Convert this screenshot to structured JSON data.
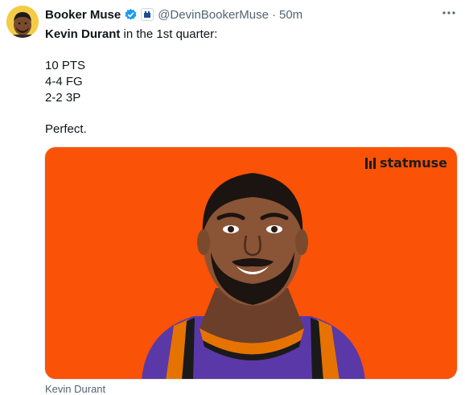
{
  "author": {
    "display_name": "Booker Muse",
    "handle": "@DevinBookerMuse",
    "separator": "·",
    "time": "50m"
  },
  "tweet": {
    "mention": "Kevin Durant",
    "intro_rest": " in the 1st quarter:",
    "stats": [
      "10 PTS",
      "4-4 FG",
      "2-2 3P"
    ],
    "closing": "Perfect."
  },
  "card": {
    "brand": "statmuse",
    "background_color": "#fa5206",
    "jersey_color": "#5b38a8",
    "caption": "Kevin Durant"
  },
  "icons": {
    "verified": "verified-badge-icon",
    "affiliate": "affiliate-badge-icon",
    "more": "more-options-icon"
  }
}
